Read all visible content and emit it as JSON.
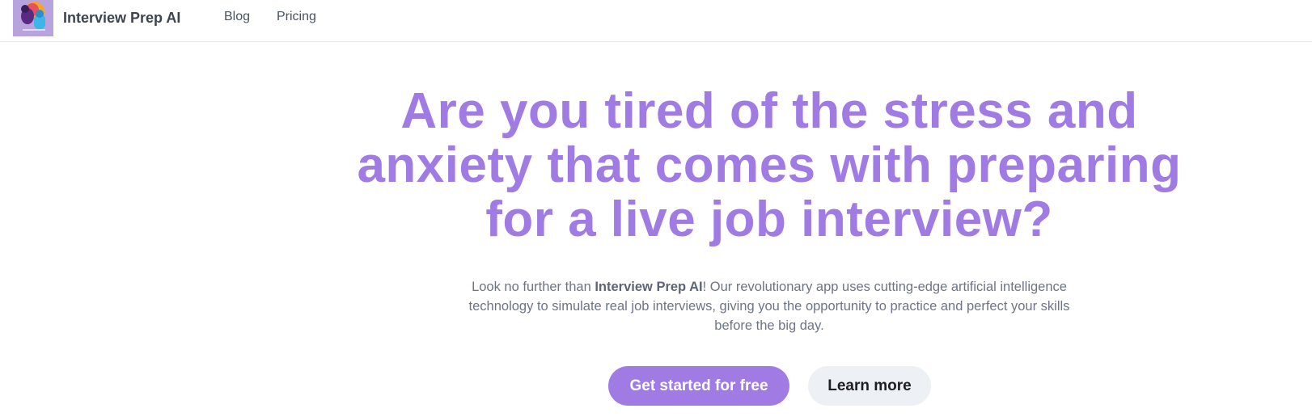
{
  "nav": {
    "brand": "Interview Prep AI",
    "links": [
      {
        "label": "Blog"
      },
      {
        "label": "Pricing"
      }
    ]
  },
  "hero": {
    "title_lines": [
      "Are you tired of the stress and",
      "anxiety that comes with preparing",
      "for a live job interview?"
    ],
    "subtitle_prefix": "Look no further than ",
    "subtitle_brand": "Interview Prep AI",
    "subtitle_rest": "! Our revolutionary app uses cutting-edge artificial intelligence technology to simulate real job interviews, giving you the opportunity to practice and perfect your skills before the big day.",
    "primary_cta": "Get started for free",
    "secondary_cta": "Learn more"
  },
  "colors": {
    "accent": "#a07be4",
    "secondary_button_bg": "#edf0f4",
    "text_muted": "#6c7486"
  }
}
